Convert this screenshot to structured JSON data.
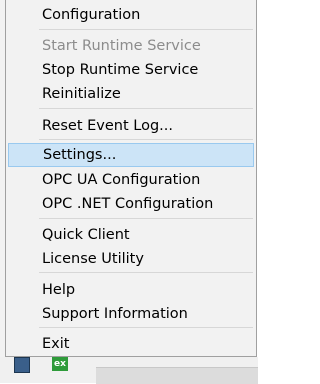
{
  "menu": {
    "items": [
      {
        "label": "Configuration",
        "enabled": true
      },
      {
        "label": "Start Runtime Service",
        "enabled": false
      },
      {
        "label": "Stop Runtime Service",
        "enabled": true
      },
      {
        "label": "Reinitialize",
        "enabled": true
      },
      {
        "label": "Reset Event Log...",
        "enabled": true
      },
      {
        "label": "Settings...",
        "enabled": true,
        "highlighted": true
      },
      {
        "label": "OPC UA Configuration",
        "enabled": true
      },
      {
        "label": "OPC .NET Configuration",
        "enabled": true
      },
      {
        "label": "Quick Client",
        "enabled": true
      },
      {
        "label": "License Utility",
        "enabled": true
      },
      {
        "label": "Help",
        "enabled": true
      },
      {
        "label": "Support Information",
        "enabled": true
      },
      {
        "label": "Exit",
        "enabled": true
      }
    ]
  },
  "taskbar": {
    "icon2_text": "ex"
  },
  "colors": {
    "highlight_bg": "#cce4f7",
    "highlight_border": "#99c9ef",
    "disabled_text": "#8c8c8c"
  }
}
